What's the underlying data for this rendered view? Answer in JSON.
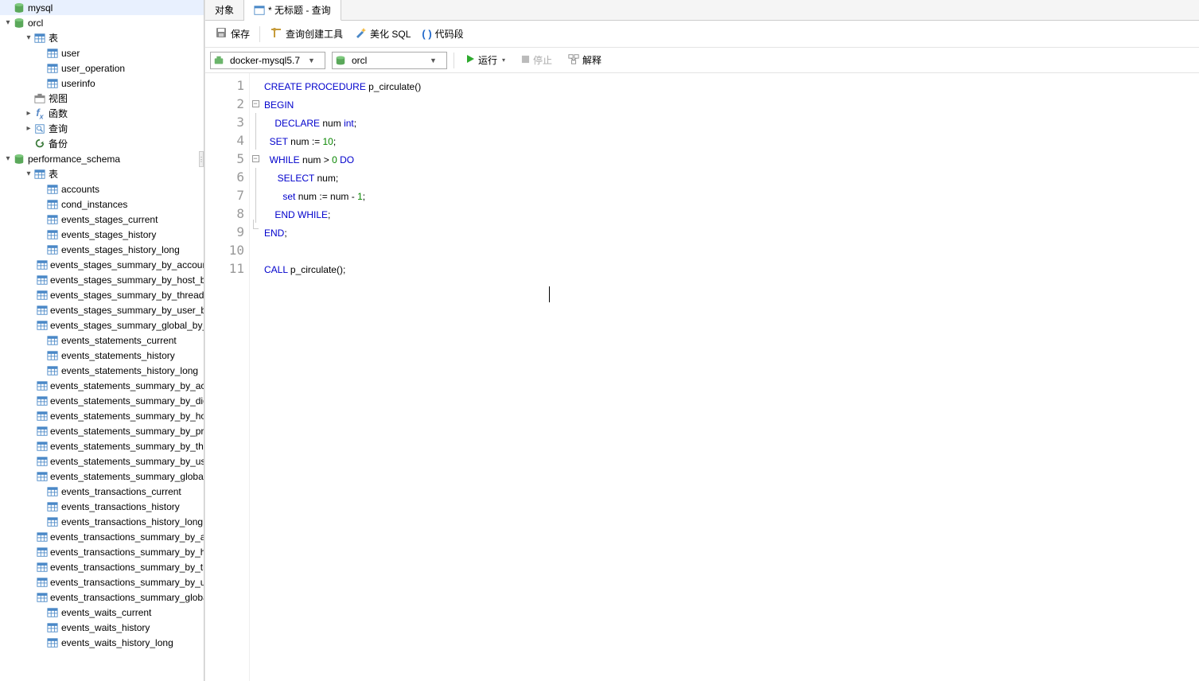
{
  "sidebar": {
    "nodes": [
      {
        "level": 0,
        "arrow": "",
        "type": "db",
        "label": "mysql"
      },
      {
        "level": 0,
        "arrow": "▾",
        "type": "db",
        "label": "orcl"
      },
      {
        "level": 1,
        "arrow": "▾",
        "type": "folder-table",
        "label": "表"
      },
      {
        "level": 2,
        "arrow": "",
        "type": "table",
        "label": "user"
      },
      {
        "level": 2,
        "arrow": "",
        "type": "table",
        "label": "user_operation"
      },
      {
        "level": 2,
        "arrow": "",
        "type": "table",
        "label": "userinfo"
      },
      {
        "level": 1,
        "arrow": "",
        "type": "folder-view",
        "label": "视图"
      },
      {
        "level": 1,
        "arrow": "▸",
        "type": "folder-fx",
        "label": "函数"
      },
      {
        "level": 1,
        "arrow": "▸",
        "type": "folder-query",
        "label": "查询"
      },
      {
        "level": 1,
        "arrow": "",
        "type": "folder-backup",
        "label": "备份"
      },
      {
        "level": 0,
        "arrow": "▾",
        "type": "db",
        "label": "performance_schema"
      },
      {
        "level": 1,
        "arrow": "▾",
        "type": "folder-table",
        "label": "表"
      },
      {
        "level": 2,
        "arrow": "",
        "type": "table",
        "label": "accounts"
      },
      {
        "level": 2,
        "arrow": "",
        "type": "table",
        "label": "cond_instances"
      },
      {
        "level": 2,
        "arrow": "",
        "type": "table",
        "label": "events_stages_current"
      },
      {
        "level": 2,
        "arrow": "",
        "type": "table",
        "label": "events_stages_history"
      },
      {
        "level": 2,
        "arrow": "",
        "type": "table",
        "label": "events_stages_history_long"
      },
      {
        "level": 2,
        "arrow": "",
        "type": "table",
        "label": "events_stages_summary_by_account_by_event_name"
      },
      {
        "level": 2,
        "arrow": "",
        "type": "table",
        "label": "events_stages_summary_by_host_by_event_name"
      },
      {
        "level": 2,
        "arrow": "",
        "type": "table",
        "label": "events_stages_summary_by_thread_by_event_name"
      },
      {
        "level": 2,
        "arrow": "",
        "type": "table",
        "label": "events_stages_summary_by_user_by_event_name"
      },
      {
        "level": 2,
        "arrow": "",
        "type": "table",
        "label": "events_stages_summary_global_by_event_name"
      },
      {
        "level": 2,
        "arrow": "",
        "type": "table",
        "label": "events_statements_current"
      },
      {
        "level": 2,
        "arrow": "",
        "type": "table",
        "label": "events_statements_history"
      },
      {
        "level": 2,
        "arrow": "",
        "type": "table",
        "label": "events_statements_history_long"
      },
      {
        "level": 2,
        "arrow": "",
        "type": "table",
        "label": "events_statements_summary_by_account_by_event_name"
      },
      {
        "level": 2,
        "arrow": "",
        "type": "table",
        "label": "events_statements_summary_by_digest"
      },
      {
        "level": 2,
        "arrow": "",
        "type": "table",
        "label": "events_statements_summary_by_host_by_event_name"
      },
      {
        "level": 2,
        "arrow": "",
        "type": "table",
        "label": "events_statements_summary_by_program"
      },
      {
        "level": 2,
        "arrow": "",
        "type": "table",
        "label": "events_statements_summary_by_thread_by_event_name"
      },
      {
        "level": 2,
        "arrow": "",
        "type": "table",
        "label": "events_statements_summary_by_user_by_event_name"
      },
      {
        "level": 2,
        "arrow": "",
        "type": "table",
        "label": "events_statements_summary_global_by_event_name"
      },
      {
        "level": 2,
        "arrow": "",
        "type": "table",
        "label": "events_transactions_current"
      },
      {
        "level": 2,
        "arrow": "",
        "type": "table",
        "label": "events_transactions_history"
      },
      {
        "level": 2,
        "arrow": "",
        "type": "table",
        "label": "events_transactions_history_long"
      },
      {
        "level": 2,
        "arrow": "",
        "type": "table",
        "label": "events_transactions_summary_by_account_by_event_name"
      },
      {
        "level": 2,
        "arrow": "",
        "type": "table",
        "label": "events_transactions_summary_by_host_by_event_name"
      },
      {
        "level": 2,
        "arrow": "",
        "type": "table",
        "label": "events_transactions_summary_by_thread_by_event_name"
      },
      {
        "level": 2,
        "arrow": "",
        "type": "table",
        "label": "events_transactions_summary_by_user_by_event_name"
      },
      {
        "level": 2,
        "arrow": "",
        "type": "table",
        "label": "events_transactions_summary_global_by_event_name"
      },
      {
        "level": 2,
        "arrow": "",
        "type": "table",
        "label": "events_waits_current"
      },
      {
        "level": 2,
        "arrow": "",
        "type": "table",
        "label": "events_waits_history"
      },
      {
        "level": 2,
        "arrow": "",
        "type": "table",
        "label": "events_waits_history_long"
      }
    ]
  },
  "tabs": {
    "tab1": "对象",
    "tab2": "* 无标题 - 查询"
  },
  "toolbar": {
    "save": "保存",
    "builder": "查询创建工具",
    "beautify": "美化 SQL",
    "snippet": "代码段"
  },
  "querybar": {
    "connection": "docker-mysql5.7",
    "database": "orcl",
    "run": "运行",
    "stop": "停止",
    "explain": "解释"
  },
  "editor": {
    "lines": [
      {
        "n": 1,
        "fold": "",
        "tokens": [
          [
            "kw",
            "CREATE"
          ],
          [
            "sp",
            " "
          ],
          [
            "kw",
            "PROCEDURE"
          ],
          [
            "sp",
            " "
          ],
          [
            "ident",
            "p_circulate()"
          ]
        ]
      },
      {
        "n": 2,
        "fold": "open",
        "tokens": [
          [
            "kw",
            "BEGIN"
          ]
        ]
      },
      {
        "n": 3,
        "fold": "line",
        "tokens": [
          [
            "sp",
            "    "
          ],
          [
            "kw",
            "DECLARE"
          ],
          [
            "sp",
            " "
          ],
          [
            "ident",
            "num "
          ],
          [
            "kw2",
            "int"
          ],
          [
            "ident",
            ";"
          ]
        ]
      },
      {
        "n": 4,
        "fold": "line",
        "tokens": [
          [
            "sp",
            "  "
          ],
          [
            "kw",
            "SET"
          ],
          [
            "sp",
            " "
          ],
          [
            "ident",
            "num := "
          ],
          [
            "num",
            "10"
          ],
          [
            "ident",
            ";"
          ]
        ]
      },
      {
        "n": 5,
        "fold": "open",
        "tokens": [
          [
            "sp",
            "  "
          ],
          [
            "kw",
            "WHILE"
          ],
          [
            "sp",
            " "
          ],
          [
            "ident",
            "num > "
          ],
          [
            "num",
            "0"
          ],
          [
            "sp",
            " "
          ],
          [
            "kw",
            "DO"
          ]
        ]
      },
      {
        "n": 6,
        "fold": "line",
        "tokens": [
          [
            "sp",
            "     "
          ],
          [
            "kw",
            "SELECT"
          ],
          [
            "sp",
            " "
          ],
          [
            "ident",
            "num;"
          ]
        ]
      },
      {
        "n": 7,
        "fold": "line",
        "tokens": [
          [
            "sp",
            "       "
          ],
          [
            "kw2",
            "set"
          ],
          [
            "sp",
            " "
          ],
          [
            "ident",
            "num := num - "
          ],
          [
            "num",
            "1"
          ],
          [
            "ident",
            ";"
          ]
        ]
      },
      {
        "n": 8,
        "fold": "line",
        "tokens": [
          [
            "sp",
            "    "
          ],
          [
            "kw",
            "END"
          ],
          [
            "sp",
            " "
          ],
          [
            "kw",
            "WHILE"
          ],
          [
            "ident",
            ";"
          ]
        ]
      },
      {
        "n": 9,
        "fold": "end",
        "tokens": [
          [
            "kw",
            "END"
          ],
          [
            "ident",
            ";"
          ]
        ]
      },
      {
        "n": 10,
        "fold": "",
        "tokens": []
      },
      {
        "n": 11,
        "fold": "",
        "tokens": [
          [
            "kw",
            "CALL"
          ],
          [
            "sp",
            " "
          ],
          [
            "ident",
            "p_circulate();"
          ]
        ]
      }
    ]
  }
}
